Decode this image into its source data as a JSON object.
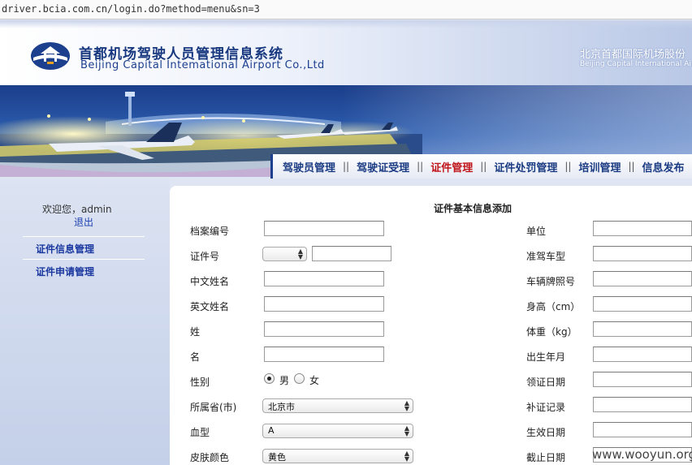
{
  "browser": {
    "url": "driver.bcia.com.cn/login.do?method=menu&sn=3"
  },
  "header": {
    "title_cn": "首都机场驾驶人员管理信息系统",
    "title_en": "Beijing Capital Intemational Airport Co.,Ltd",
    "company_cn": "北京首都国际机场股份",
    "company_en": "Beijing Capital International Ai"
  },
  "nav": {
    "items": [
      {
        "label": "驾驶员管理"
      },
      {
        "label": "驾驶证受理"
      },
      {
        "label": "证件管理",
        "active": true
      },
      {
        "label": "证件处罚管理"
      },
      {
        "label": "培训管理"
      },
      {
        "label": "信息发布"
      }
    ],
    "separator": "||"
  },
  "sidebar": {
    "welcome": "欢迎您，admin",
    "logout": "退出",
    "links": [
      "证件信息管理",
      "证件申请管理"
    ]
  },
  "form": {
    "title": "证件基本信息添加",
    "left": {
      "file_no": {
        "label": "档案编号",
        "value": ""
      },
      "cert_no": {
        "label": "证件号",
        "select_value": "",
        "value": ""
      },
      "cn_name": {
        "label": "中文姓名",
        "value": ""
      },
      "en_name": {
        "label": "英文姓名",
        "value": ""
      },
      "surname": {
        "label": "姓",
        "value": ""
      },
      "given_name": {
        "label": "名",
        "value": ""
      },
      "gender": {
        "label": "性别",
        "options": [
          "男",
          "女"
        ],
        "selected": "男"
      },
      "province": {
        "label": "所属省(市)",
        "value": "北京市"
      },
      "blood": {
        "label": "血型",
        "value": "A"
      },
      "skin": {
        "label": "皮肤颜色",
        "value": "黄色"
      }
    },
    "right": {
      "unit": {
        "label": "单位",
        "value": ""
      },
      "vehicle_type": {
        "label": "准驾车型",
        "value": ""
      },
      "plate": {
        "label": "车辆牌照号",
        "value": ""
      },
      "height": {
        "label": "身高（cm）",
        "value": ""
      },
      "weight": {
        "label": "体重（kg）",
        "value": ""
      },
      "birth": {
        "label": "出生年月",
        "value": ""
      },
      "issue_date": {
        "label": "领证日期",
        "value": ""
      },
      "reissue": {
        "label": "补证记录",
        "value": ""
      },
      "effective": {
        "label": "生效日期",
        "value": ""
      },
      "expiry": {
        "label": "截止日期",
        "value": ""
      }
    }
  },
  "watermark": "www.wooyun.org",
  "colors": {
    "brand": "#1b3b83",
    "active_nav": "#c0151b",
    "link": "#1a38a0"
  }
}
